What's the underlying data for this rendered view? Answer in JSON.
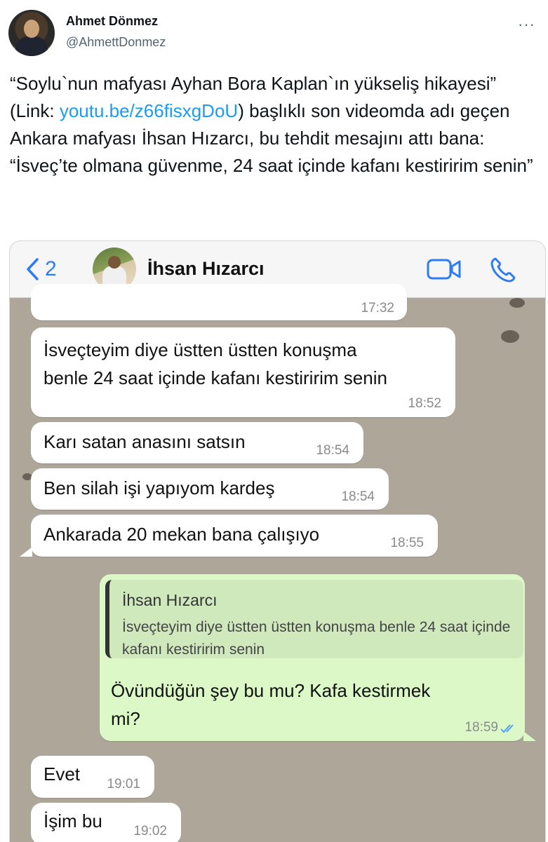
{
  "tweet": {
    "author_name": "Ahmet Dönmez",
    "author_handle": "@AhmettDonmez",
    "more_label": "···",
    "text_part1": "“Soylu`nun mafyası Ayhan Bora Kaplan`ın yükseliş hikayesi”",
    "text_part2a": "(Link: ",
    "link_text": "youtu.be/z66fisxgDoU",
    "text_part2b": ") başlıklı son videomda adı geçen Ankara mafyası İhsan Hızarcı, bu tehdit mesajını attı bana: “İsveç’te olmana güvenme, 24 saat içinde kafanı kestiririm senin”"
  },
  "chat_header": {
    "back_count": "2",
    "contact_name": "İhsan Hızarcı"
  },
  "messages": [
    {
      "time": "17:32"
    },
    {
      "line1": "İsveçteyim diye üstten üstten konuşma",
      "line2": "benle 24 saat içinde kafanı kestiririm senin",
      "time": "18:52"
    },
    {
      "text": "Karı satan anasını satsın",
      "time": "18:54"
    },
    {
      "text": "Ben silah işi yapıyom kardeş",
      "time": "18:54"
    },
    {
      "text": "Ankarada 20 mekan bana çalışıyo",
      "time": "18:55"
    },
    {
      "quote_name": "İhsan Hızarcı",
      "quote_text": "İsveçteyim diye üstten üstten konuşma benle 24 saat içinde kafanı kestiririm senin",
      "line1": "Övündüğün şey bu mu? Kafa kestirmek",
      "line2": "mi?",
      "time": "18:59"
    },
    {
      "text": "Evet",
      "time": "19:01"
    },
    {
      "text": "İşim bu",
      "time": "19:02"
    }
  ],
  "colors": {
    "link": "#1d9bf0",
    "ios_blue": "#2d7cf6",
    "outgoing_bubble": "#dcf8c6",
    "incoming_bubble": "#ffffff",
    "read_ticks": "#4fa3f7"
  },
  "icons": [
    "more-icon",
    "back-chevron-icon",
    "video-call-icon",
    "phone-call-icon",
    "read-receipt-icon"
  ]
}
